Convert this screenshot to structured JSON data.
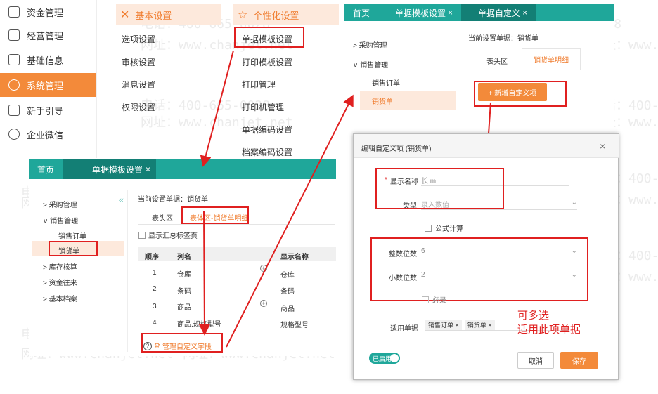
{
  "sidebar": {
    "items": [
      {
        "label": "资金管理",
        "icon": "money-icon"
      },
      {
        "label": "经营管理",
        "icon": "clipboard-icon"
      },
      {
        "label": "基础信息",
        "icon": "id-card-icon"
      },
      {
        "label": "系统管理",
        "icon": "settings-ring-icon",
        "active": true
      },
      {
        "label": "新手引导",
        "icon": "guide-icon"
      },
      {
        "label": "企业微信",
        "icon": "chat-icon"
      }
    ]
  },
  "settings_menu": {
    "basic": {
      "title": "基本设置",
      "links": [
        "选项设置",
        "审核设置",
        "消息设置",
        "权限设置"
      ]
    },
    "personal": {
      "title": "个性化设置",
      "links": [
        "单据模板设置",
        "打印模板设置",
        "打印管理",
        "打印机管理",
        "单据编码设置",
        "档案编码设置"
      ]
    }
  },
  "panel_template": {
    "tabs": [
      {
        "label": "首页"
      },
      {
        "label": "单据模板设置",
        "close": "×"
      }
    ],
    "collapse": "«",
    "tree": [
      {
        "label": "采购管理",
        "arrow": ">"
      },
      {
        "label": "销售管理",
        "arrow": "∨"
      },
      {
        "label": "销售订单",
        "arrow": ""
      },
      {
        "label": "销货单",
        "arrow": ""
      },
      {
        "label": "库存核算",
        "arrow": ">"
      },
      {
        "label": "资金往来",
        "arrow": ">"
      },
      {
        "label": "基本档案",
        "arrow": ">"
      }
    ],
    "current_doc_label": "当前设置单据：销货单",
    "subtabs": [
      "表头区",
      "表体区-销货单明细"
    ],
    "checkbox_label": "显示汇总标签页",
    "table": {
      "headers": [
        "顺序",
        "列名",
        "显示名称"
      ],
      "rows": [
        {
          "no": "1",
          "col": "仓库",
          "disp": "仓库"
        },
        {
          "no": "2",
          "col": "条码",
          "disp": "条码"
        },
        {
          "no": "3",
          "col": "商品",
          "disp": "商品"
        },
        {
          "no": "4",
          "col": "商品.规格型号",
          "disp": "规格型号"
        }
      ]
    },
    "manage_link": "管理自定义字段"
  },
  "panel_custom": {
    "tabs": [
      {
        "label": "首页"
      },
      {
        "label": "单据模板设置",
        "close": "×"
      },
      {
        "label": "单据自定义",
        "close": "×"
      }
    ],
    "current_doc_label": "当前设置单据：销货单",
    "tree": [
      {
        "label": "采购管理",
        "arrow": ">"
      },
      {
        "label": "销售管理",
        "arrow": "∨"
      },
      {
        "label": "销售订单",
        "arrow": ""
      },
      {
        "label": "销货单",
        "arrow": ""
      }
    ],
    "subtabs": [
      "表头区",
      "销货单明细"
    ],
    "add_button": "+ 新增自定义项"
  },
  "dialog": {
    "title": "编辑自定义项 (销货单)",
    "close": "×",
    "name_label": "显示名称",
    "name_value": "长 m",
    "type_label": "类型",
    "type_placeholder": "录入数值",
    "formula_label": "公式计算",
    "int_label": "整数位数",
    "int_value": "6",
    "dec_label": "小数位数",
    "dec_value": "2",
    "required_label": "必录",
    "apply_label": "适用单据",
    "apply_chips": [
      "销售订单 ×",
      "销货单 ×"
    ],
    "enabled_label": "已启用",
    "cancel": "取消",
    "save": "保存"
  },
  "annotation": {
    "line1": "可多选",
    "line2": "适用此项单据"
  },
  "watermarks": {
    "phone": "电话：400-665-0028",
    "site": "网址：www.chanjet.net"
  },
  "colors": {
    "accent": "#f38a3a",
    "teal": "#1fa79a",
    "red": "#e02020"
  }
}
